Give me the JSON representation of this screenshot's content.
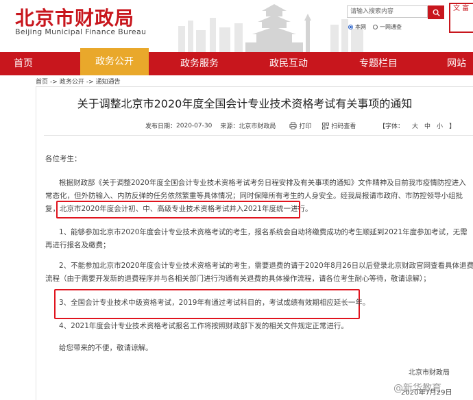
{
  "header": {
    "logo_cn": "北京市财政局",
    "logo_en": "Beijing Municipal Finance Bureau",
    "search_placeholder": "请输入搜索内容",
    "radio_site": "本网",
    "radio_all": "一网通查",
    "seal_text": "文 富"
  },
  "nav": {
    "items": [
      "首页",
      "政务公开",
      "政务服务",
      "政民互动",
      "专题栏目",
      "网站"
    ]
  },
  "breadcrumb": [
    "首页",
    "->",
    "政务公开",
    "->",
    "通知通告"
  ],
  "article": {
    "title": "关于调整北京市2020年度全国会计专业技术资格考试有关事项的通知",
    "meta": {
      "date_label": "发布日期：",
      "date": "2020-07-30",
      "source_label": "来源：",
      "source": "北京市财政局",
      "print": "打印",
      "qr": "扫码查看"
    },
    "font_ctrl": {
      "open": "【字体：",
      "large": "大",
      "medium": "中",
      "small": "小",
      "close": "】"
    },
    "greeting": "各位考生：",
    "p1_line1": "根据财政部《关于调整2020年度全国会计专业技术资格考试考务日程安排及有关事项的通知》文件精神及目前我市疫情防控进入",
    "p1_line2": "常态化，但外防输入、内防反弹的任务依然繁重等具体情况；同时保障所有考生的人身安全。经我局报请市政府、市防控领导小组批",
    "p1_line3_a": "复，",
    "p1_line3_b": "北京市2020年度会计初、中、高级专业技术资格考试并入2021年度统一进行。",
    "p2_line1": "1、能够参加北京市2020年度会计专业技术资格考试的考生，报名系统会自动将缴费成功的考生顺延到2021年度参加考试，无需",
    "p2_line2": "再进行报名及缴费；",
    "p3_line1": "2、不能参加北京市2020年度会计专业技术资格考试的考生，需要退费的请于2020年8月26日以后登录北京财政官网查看具体退费",
    "p3_line2": "流程（由于需要开发新的退费程序并与各相关部门进行沟通有关退费的具体操作流程，请各位考生耐心等待，敬请谅解）；",
    "p4": "3、全国会计专业技术中级资格考试，2019年有通过考试科目的，考试成绩有效期相应延长一年。",
    "p5": "4、2021年度会计专业技术资格考试报名工作将按照财政部下发的相关文件规定正常进行。",
    "closing": "给您带来的不便，敬请谅解。",
    "signature": "北京市财政局",
    "sign_date": "2020年7月29日"
  },
  "watermark": "@新华教育",
  "colors": {
    "brand_red": "#c8161d",
    "nav_active": "#e9a82b",
    "highlight_box": "#e0141e"
  }
}
